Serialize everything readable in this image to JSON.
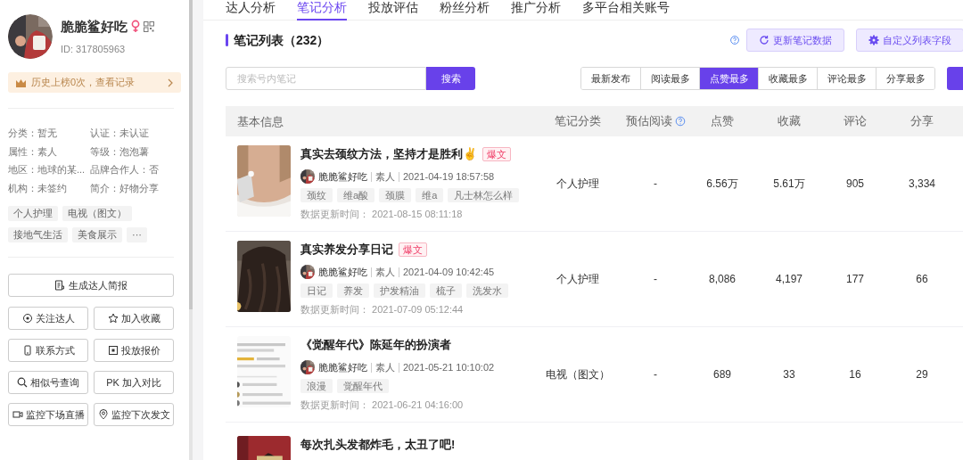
{
  "profile": {
    "name": "脆脆鲨好吃",
    "id": "ID:  317805963",
    "rank_banner": "历史上榜0次，查看记录"
  },
  "info": [
    {
      "label": "分类：",
      "value": "暂无"
    },
    {
      "label": "认证：",
      "value": "未认证"
    },
    {
      "label": "属性：",
      "value": "素人"
    },
    {
      "label": "等级：",
      "value": "泡泡薯"
    },
    {
      "label": "地区：",
      "value": "地球的某..."
    },
    {
      "label": "品牌合作人：",
      "value": "否"
    },
    {
      "label": "机构：",
      "value": "未签约"
    },
    {
      "label": "简介：",
      "value": "好物分享"
    }
  ],
  "tags": [
    "个人护理",
    "电视（图文）",
    "接地气生活",
    "美食展示",
    "···"
  ],
  "report_button": "生成达人简报",
  "actions": [
    "关注达人",
    "加入收藏",
    "联系方式",
    "投放报价",
    "相似号查询",
    "PK 加入对比",
    "监控下场直播",
    "监控下次发文"
  ],
  "tabs": [
    {
      "label": "达人分析",
      "selected": false
    },
    {
      "label": "笔记分析",
      "selected": true
    },
    {
      "label": "投放评估",
      "selected": false
    },
    {
      "label": "粉丝分析",
      "selected": false
    },
    {
      "label": "推广分析",
      "selected": false
    },
    {
      "label": "多平台相关账号",
      "selected": false
    }
  ],
  "section_title": "笔记列表（232）",
  "toolbar_buttons": [
    "更新笔记数据",
    "自定义列表字段"
  ],
  "search": {
    "placeholder": "搜索号内笔记",
    "button": "搜索"
  },
  "sort_options": [
    {
      "label": "最新发布",
      "selected": false
    },
    {
      "label": "阅读最多",
      "selected": false
    },
    {
      "label": "点赞最多",
      "selected": true
    },
    {
      "label": "收藏最多",
      "selected": false
    },
    {
      "label": "评论最多",
      "selected": false
    },
    {
      "label": "分享最多",
      "selected": false
    }
  ],
  "table": {
    "columns": [
      "基本信息",
      "笔记分类",
      "预估阅读",
      "点赞",
      "收藏",
      "评论",
      "分享"
    ],
    "rows": [
      {
        "title": "真实去颈纹方法，坚持才是胜利✌",
        "badge": "爆文",
        "author": "脆脆鲨好吃",
        "account_type": "素人",
        "published": "2021-04-19 18:57:58",
        "tags": [
          "颈纹",
          "维a酸",
          "颈膜",
          "维a",
          "凡士林怎么样"
        ],
        "updated_label": "数据更新时间：",
        "updated": "2021-08-15 08:11:18",
        "category": "个人护理",
        "est_reads": "-",
        "likes": "6.56万",
        "favorites": "5.61万",
        "comments": "905",
        "shares": "3,334"
      },
      {
        "title": "真实养发分享日记",
        "badge": "爆文",
        "author": "脆脆鲨好吃",
        "account_type": "素人",
        "published": "2021-04-09 10:42:45",
        "tags": [
          "日记",
          "养发",
          "护发精油",
          "梳子",
          "洗发水"
        ],
        "updated_label": "数据更新时间：",
        "updated": "2021-07-09 05:12:44",
        "category": "个人护理",
        "est_reads": "-",
        "likes": "8,086",
        "favorites": "4,197",
        "comments": "177",
        "shares": "66"
      },
      {
        "title": "《觉醒年代》陈延年的扮演者",
        "author": "脆脆鲨好吃",
        "account_type": "素人",
        "published": "2021-05-21 10:10:02",
        "tags": [
          "浪漫",
          "觉醒年代"
        ],
        "updated_label": "数据更新时间：",
        "updated": "2021-06-21 04:16:00",
        "category": "电视（图文）",
        "est_reads": "-",
        "likes": "689",
        "favorites": "33",
        "comments": "16",
        "shares": "29"
      },
      {
        "title": "每次扎头发都炸毛，太丑了吧!"
      }
    ]
  }
}
